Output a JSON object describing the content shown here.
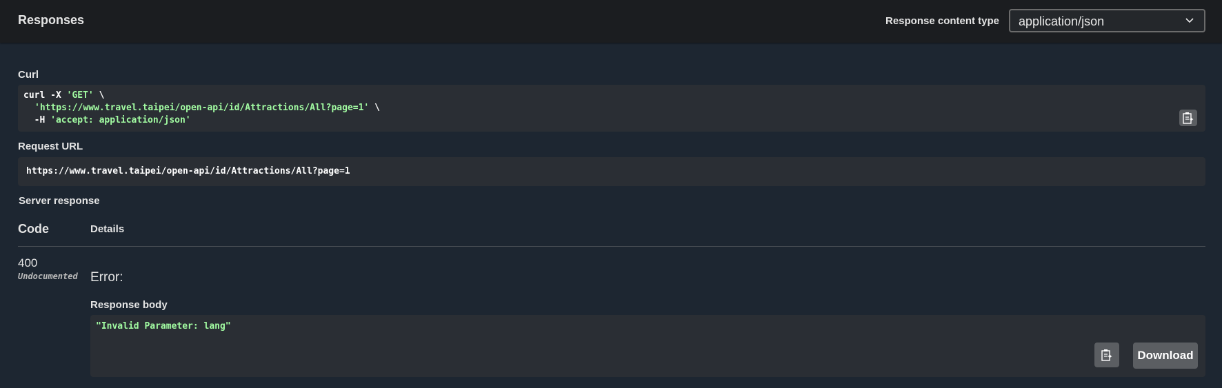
{
  "header": {
    "title": "Responses",
    "content_type_label": "Response content type",
    "content_type_value": "application/json"
  },
  "curl": {
    "label": "Curl",
    "line1_cmd": "curl -X ",
    "line1_method": "'GET'",
    "line1_tail": " \\",
    "line2_url": "'https://www.travel.taipei/open-api/id/Attractions/All?page=1'",
    "line2_tail": " \\",
    "line3_flag": "  -H ",
    "line3_header": "'accept: application/json'"
  },
  "request_url": {
    "label": "Request URL",
    "value": "https://www.travel.taipei/open-api/id/Attractions/All?page=1"
  },
  "server_response": {
    "label": "Server response",
    "code_header": "Code",
    "details_header": "Details",
    "status_code": "400",
    "status_note": "Undocumented",
    "error_text": "Error:",
    "body_label": "Response body",
    "body_text": "\"Invalid Parameter: lang\"",
    "download_label": "Download"
  },
  "icons": {
    "copy": "clipboard-icon",
    "select": "chevron-down-icon"
  },
  "colors": {
    "background": "#1d2631",
    "topbar": "#1b1d20",
    "code_block": "#2a2e34",
    "string": "#a2fca2",
    "button": "#5b5e62"
  }
}
